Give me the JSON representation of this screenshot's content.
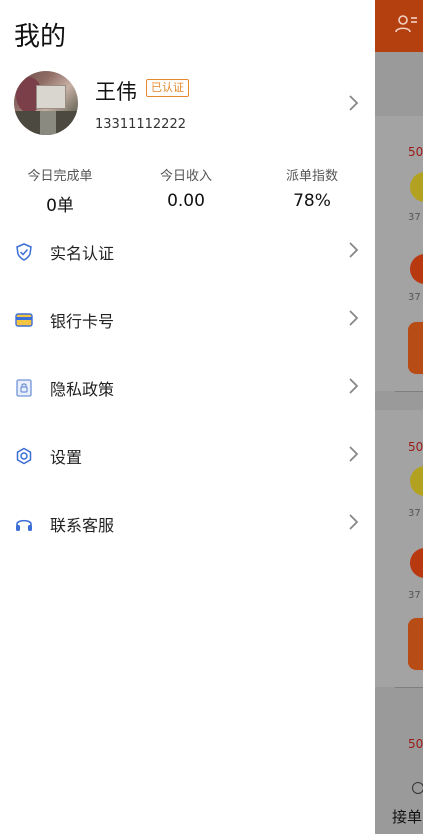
{
  "drawer": {
    "title": "我的",
    "user": {
      "name": "王伟",
      "badge": "已认证",
      "phone": "13311112222"
    },
    "stats": [
      {
        "label": "今日完成单",
        "value": "0单"
      },
      {
        "label": "今日收入",
        "value": "0.00"
      },
      {
        "label": "派单指数",
        "value": "78%"
      }
    ],
    "menu": [
      {
        "label": "实名认证",
        "icon": "shield-check-icon"
      },
      {
        "label": "银行卡号",
        "icon": "bank-card-icon"
      },
      {
        "label": "隐私政策",
        "icon": "lock-document-icon"
      },
      {
        "label": "设置",
        "icon": "gear-icon"
      },
      {
        "label": "联系客服",
        "icon": "headphones-icon"
      }
    ]
  },
  "background": {
    "card_num_1": "50",
    "small_num": "37",
    "bottom_label": "接单"
  },
  "colors": {
    "accent_orange": "#e48a2c",
    "icon_blue": "#3c6fd6",
    "topbar": "#b43f0f"
  }
}
